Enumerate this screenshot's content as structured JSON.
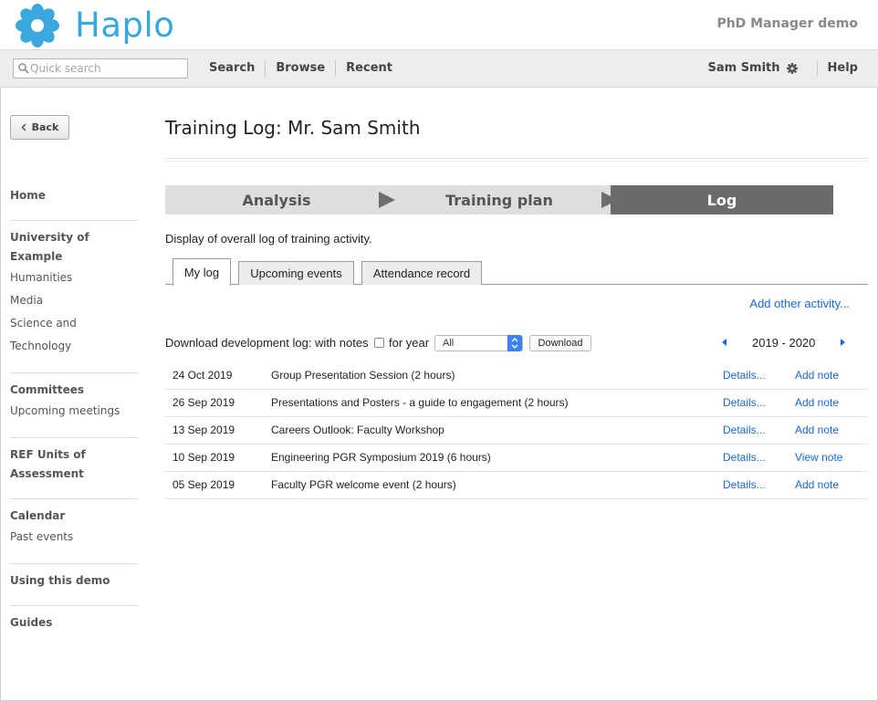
{
  "header": {
    "logo_text": "Haplo",
    "app_name": "PhD Manager demo",
    "brand_color": "#3aa8dd"
  },
  "navbar": {
    "search_placeholder": "Quick search",
    "links": [
      "Search",
      "Browse",
      "Recent"
    ],
    "user_name": "Sam Smith",
    "help": "Help"
  },
  "sidebar": {
    "back_label": "Back",
    "groups": [
      {
        "title": "Home",
        "items": []
      },
      {
        "title": "University of Example",
        "items": [
          "Humanities",
          "Media",
          "Science and Technology"
        ]
      },
      {
        "title": "Committees",
        "items": [
          "Upcoming meetings"
        ]
      },
      {
        "title": "REF Units of Assessment",
        "items": []
      },
      {
        "title": "Calendar",
        "items": [
          "Past events"
        ]
      },
      {
        "title": "Using this demo",
        "items": []
      },
      {
        "title": "Guides",
        "items": []
      }
    ]
  },
  "main": {
    "title": "Training Log: Mr. Sam Smith",
    "steps": [
      {
        "label": "Analysis",
        "state": "done"
      },
      {
        "label": "Training plan",
        "state": "done"
      },
      {
        "label": "Log",
        "state": "current"
      }
    ],
    "description": "Display of overall log of training activity.",
    "tabs": [
      {
        "label": "My log",
        "active": true
      },
      {
        "label": "Upcoming events",
        "active": false
      },
      {
        "label": "Attendance record",
        "active": false
      }
    ],
    "add_activity": "Add other activity...",
    "download": {
      "label": "Download development log: with notes",
      "for_year_label": "for year",
      "for_year_checked": false,
      "year_select_value": "All",
      "button": "Download"
    },
    "year_range": "2019 - 2020",
    "log_rows": [
      {
        "date": "24 Oct 2019",
        "title": "Group Presentation Session (2 hours)",
        "details": "Details...",
        "note": "Add note"
      },
      {
        "date": "26 Sep 2019",
        "title": "Presentations and Posters - a guide to engagement (2 hours)",
        "details": "Details...",
        "note": "Add note"
      },
      {
        "date": "13 Sep 2019",
        "title": "Careers Outlook: Faculty Workshop",
        "details": "Details...",
        "note": "Add note"
      },
      {
        "date": "10 Sep 2019",
        "title": "Engineering PGR Symposium 2019 (6 hours)",
        "details": "Details...",
        "note": "View note"
      },
      {
        "date": "05 Sep 2019",
        "title": "Faculty PGR welcome event (2 hours)",
        "details": "Details...",
        "note": "Add note"
      }
    ],
    "link_color": "#1769d4"
  }
}
